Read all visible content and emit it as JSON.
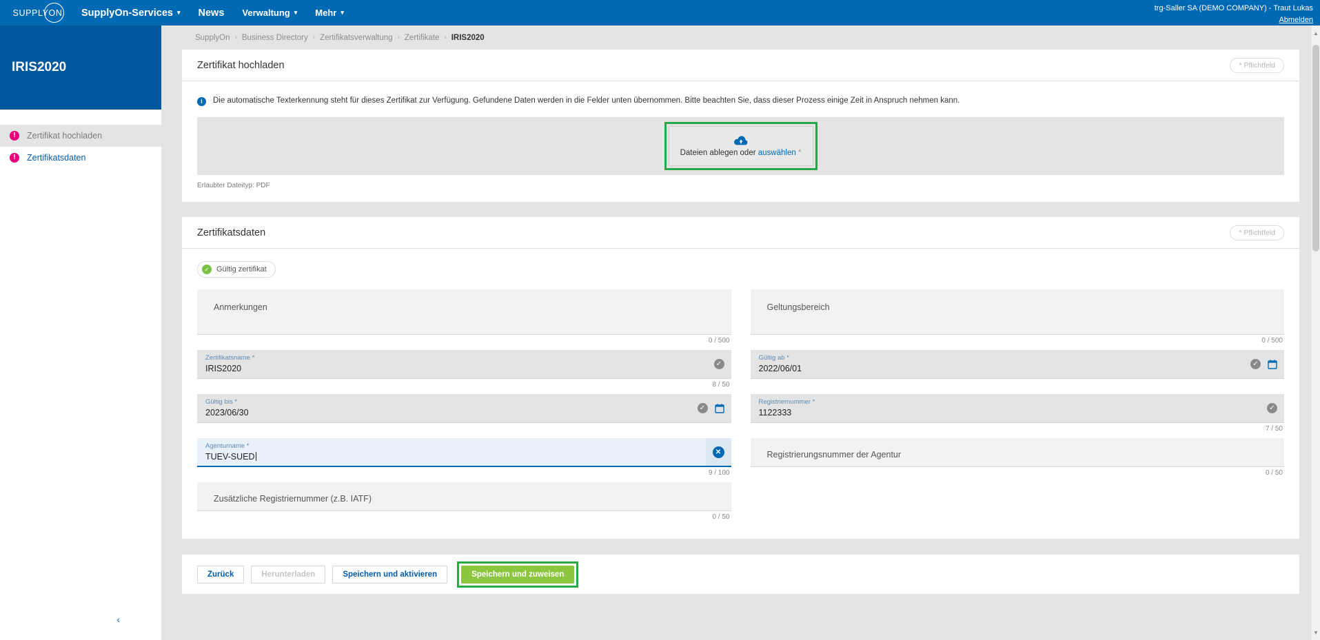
{
  "topbar": {
    "logo_text": "SUPPLYON",
    "nav": [
      {
        "label": "SupplyOn-Services",
        "caret": "▾",
        "bold": true
      },
      {
        "label": "News",
        "caret": "",
        "bold": true
      },
      {
        "label": "Verwaltung",
        "caret": "▾",
        "bold": false
      },
      {
        "label": "Mehr",
        "caret": "▾",
        "bold": false
      }
    ],
    "user_name": "trg-Saller SA (DEMO COMPANY) - Traut Lukas",
    "logout_label": "Abmelden"
  },
  "sidebar": {
    "title": "IRIS2020",
    "items": [
      {
        "label": "Zertifikat hochladen",
        "badge": "!",
        "state": "active"
      },
      {
        "label": "Zertifikatsdaten",
        "badge": "!",
        "state": "link"
      }
    ],
    "collapse_icon": "‹"
  },
  "breadcrumb": {
    "separator": "›",
    "items": [
      "SupplyOn",
      "Business Directory",
      "Zertifikatsverwaltung",
      "Zertifikate",
      "IRIS2020"
    ]
  },
  "upload_card": {
    "title": "Zertifikat hochladen",
    "required_badge": "* Pflichtfeld",
    "info_icon": "i",
    "info_text": "Die automatische Texterkennung steht für dieses Zertifikat zur Verfügung. Gefundene Daten werden in die Felder unten übernommen. Bitte beachten Sie, dass dieser Prozess einige Zeit in Anspruch nehmen kann.",
    "dropzone_text_prefix": "Dateien ablegen oder ",
    "dropzone_link": "auswählen",
    "dropzone_star": " *",
    "filetype_note": "Erlaubter Dateityp: PDF"
  },
  "data_card": {
    "title": "Zertifikatsdaten",
    "required_badge": "* Pflichtfeld",
    "status_pill": {
      "label": "Gültig zertifikat",
      "icon": "✓"
    },
    "fields": {
      "anmerkungen": {
        "placeholder": "Anmerkungen",
        "value": "",
        "counter": "0 / 500"
      },
      "geltungsbereich": {
        "placeholder": "Geltungsbereich",
        "value": "",
        "counter": "0 / 500"
      },
      "zertifikatsname": {
        "label": "Zertifikatsname *",
        "value": "IRIS2020",
        "counter": "8 / 50"
      },
      "gueltig_ab": {
        "label": "Gültig ab *",
        "value": "2022/06/01",
        "counter": ""
      },
      "gueltig_bis": {
        "label": "Gültig bis *",
        "value": "2023/06/30",
        "counter": ""
      },
      "registriernummer": {
        "label": "Registriernummer *",
        "value": "1122333",
        "counter": "7 / 50"
      },
      "agenturname": {
        "label": "Agenturname *",
        "value": "TUEV-SUED",
        "counter": "9 / 100"
      },
      "agentur_regnr": {
        "placeholder": "Registrierungsnummer der Agentur",
        "value": "",
        "counter": "0 / 50"
      },
      "zusatz_regnr": {
        "placeholder": "Zusätzliche Registriernummer (z.B. IATF)",
        "value": "",
        "counter": "0 / 50"
      }
    }
  },
  "footer": {
    "back": "Zurück",
    "download": "Herunterladen",
    "save_activate": "Speichern und aktivieren",
    "save_assign": "Speichern und zuweisen"
  },
  "colors": {
    "brand_blue": "#0069b4",
    "sidebar_blue": "#00589c",
    "accent_pink": "#e5007d",
    "green_primary": "#8cc63f",
    "highlight_green": "#28a745",
    "link_blue": "#005ca9"
  }
}
